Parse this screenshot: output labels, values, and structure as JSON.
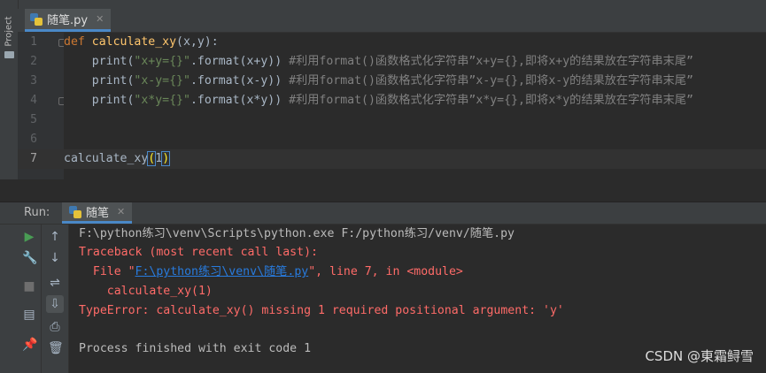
{
  "left_strip": {
    "project_label": "Project"
  },
  "editor_tab": {
    "filename": "随笔.py",
    "close": "✕"
  },
  "editor": {
    "lines": [
      {
        "num": "1",
        "def_kw": "def ",
        "fn_name": "calculate_xy",
        "args": "(x,y):"
      },
      {
        "num": "2",
        "indent": "    ",
        "call": "print(",
        "str": "\"x+y={}\"",
        "rest": ".format(x+y)) ",
        "comment": "#利用format()函数格式化字符串”x+y={},即将x+y的结果放在字符串末尾”"
      },
      {
        "num": "3",
        "indent": "    ",
        "call": "print(",
        "str": "\"x-y={}\"",
        "rest": ".format(x-y)) ",
        "comment": "#利用format()函数格式化字符串”x-y={},即将x-y的结果放在字符串末尾”"
      },
      {
        "num": "4",
        "indent": "    ",
        "call": "print(",
        "str": "\"x*y={}\"",
        "rest": ".format(x*y)) ",
        "comment": "#利用format()函数格式化字符串”x*y={},即将x*y的结果放在字符串末尾”"
      },
      {
        "num": "5"
      },
      {
        "num": "6"
      },
      {
        "num": "7",
        "call_name": "calculate_xy",
        "open": "(",
        "arg": "1",
        "close": ")"
      }
    ]
  },
  "run_panel": {
    "label": "Run:",
    "tab_name": "随笔",
    "tab_close": "✕",
    "console": {
      "cmd": "F:\\python练习\\venv\\Scripts\\python.exe F:/python练习/venv/随笔.py",
      "traceback": "Traceback (most recent call last):",
      "file_prefix": "  File \"",
      "file_link": "F:\\python练习\\venv\\随笔.py",
      "file_suffix": "\", line 7, in <module>",
      "code_line": "    calculate_xy(1)",
      "error": "TypeError: calculate_xy() missing 1 required positional argument: 'y'",
      "exit": "Process finished with exit code 1"
    }
  },
  "watermark": "CSDN @東霜鲟雪",
  "icons": {
    "run": "play-icon",
    "wrench": "wrench-icon",
    "stop": "stop-icon",
    "layout": "layout-icon",
    "pin": "pin-icon",
    "up": "arrow-up-icon",
    "down": "arrow-down-icon",
    "wrap": "soft-wrap-icon",
    "scroll": "scroll-end-icon",
    "print": "print-icon",
    "trash": "trash-icon"
  },
  "colors": {
    "accent": "#4a88c7",
    "error": "#ff6b68",
    "link": "#287bde",
    "run_green": "#499c54"
  }
}
